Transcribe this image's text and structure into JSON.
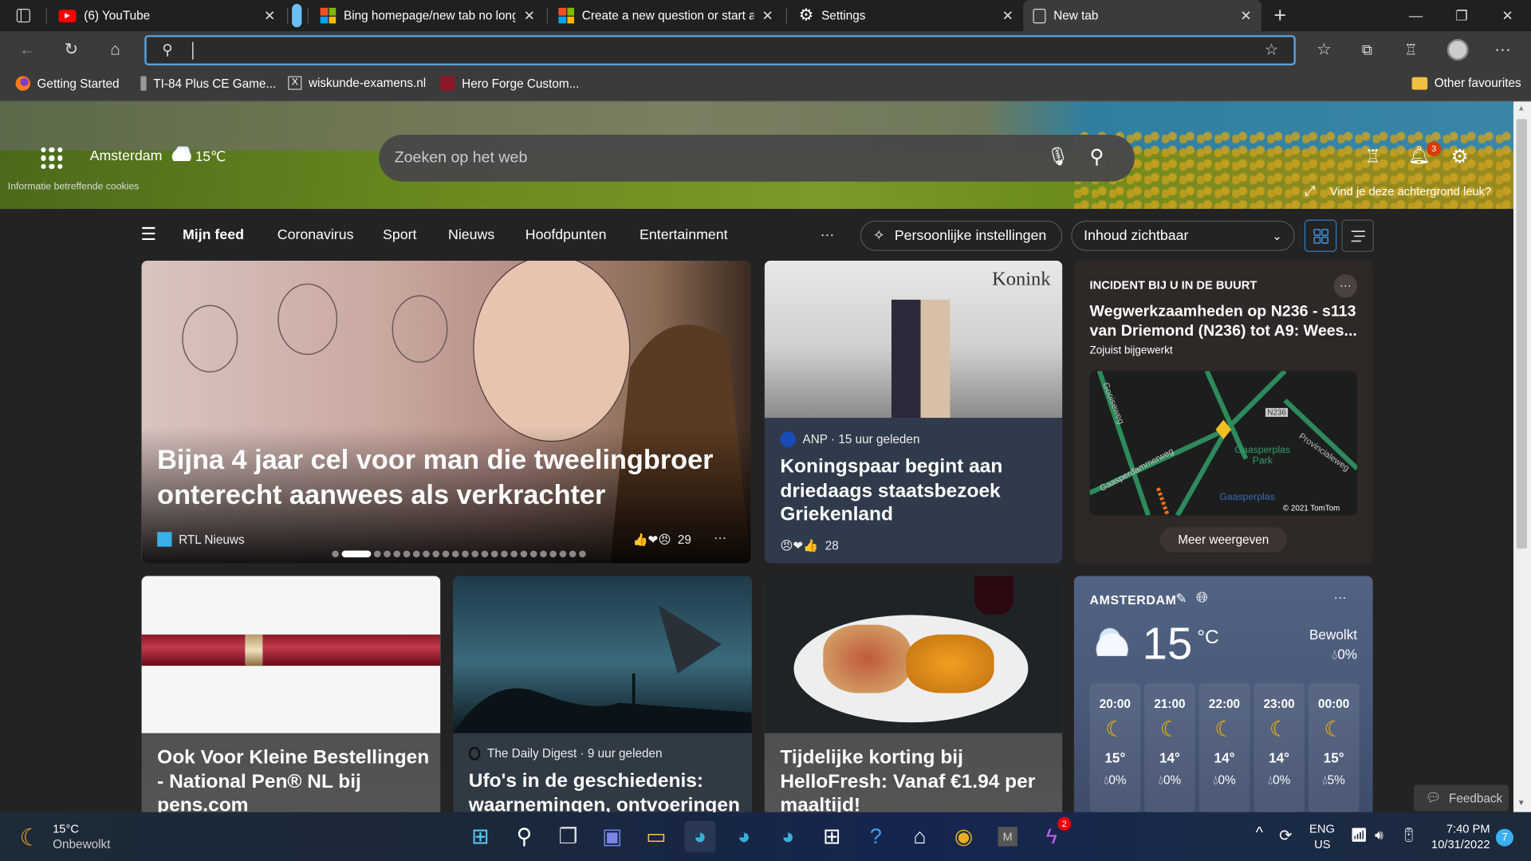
{
  "browser": {
    "tabs": [
      {
        "title": "(6) YouTube",
        "icon": "youtube-icon"
      },
      {
        "title": "Bing homepage/new tab no long",
        "icon": "microsoft-icon"
      },
      {
        "title": "Create a new question or start a",
        "icon": "microsoft-icon"
      },
      {
        "title": "Settings",
        "icon": "gear-icon"
      },
      {
        "title": "New tab",
        "icon": "new-tab-icon",
        "active": true
      }
    ],
    "close_glyph": "✕",
    "new_tab_glyph": "+",
    "address_value": "",
    "bookmarks": [
      {
        "label": "Getting Started",
        "icon": "firefox-icon"
      },
      {
        "label": "TI-84 Plus CE Game...",
        "icon": "calculator-icon"
      },
      {
        "label": "wiskunde-examens.nl",
        "icon": "wiskunde-icon"
      },
      {
        "label": "Hero Forge Custom...",
        "icon": "heroforge-icon"
      }
    ],
    "other_favourites": "Other favourites",
    "accent": "#5aa0d8"
  },
  "header": {
    "city": "Amsterdam",
    "temp": "15℃",
    "cookies": "Informatie betreffende cookies",
    "search_placeholder": "Zoeken op het web",
    "notification_count": "3",
    "background_prompt": "Vind je deze achtergrond leuk?"
  },
  "nav": {
    "items": [
      "Mijn feed",
      "Coronavirus",
      "Sport",
      "Nieuws",
      "Hoofdpunten",
      "Entertainment"
    ],
    "more": "···",
    "personal_settings": "Persoonlijke instellingen",
    "content_select": "Inhoud zichtbaar"
  },
  "cards": {
    "hero": {
      "title": "Bijna 4 jaar cel voor man die tweelingbroer onterecht aanwees als verkrachter",
      "source": "RTL Nieuws",
      "reactions": "29",
      "slide_count": 24,
      "active_slide": 2
    },
    "royal": {
      "source": "ANP · 15 uur geleden",
      "title": "Koningspaar begint aan driedaags staatsbezoek Griekenland",
      "reactions": "28",
      "plane_text": "Konink"
    },
    "traffic": {
      "label": "INCIDENT BIJ U IN DE BUURT",
      "title": "Wegwerkzaamheden op N236 - s113 van Driemond (N236) tot A9: Wees...",
      "updated": "Zojuist bijgewerkt",
      "map_labels": [
        "Gooiseweg",
        "Gaasperdammerweg",
        "Gaasperplas Park",
        "Provincialeweg",
        "Gaasperplas",
        "N236"
      ],
      "map_credit": "© 2021 TomTom",
      "more": "Meer weergeven"
    },
    "pen": {
      "title": "Ook Voor Kleine Bestellingen - National Pen® NL bij pens.com"
    },
    "ufo": {
      "source": "The Daily Digest · 9 uur geleden",
      "title": "Ufo's in de geschiedenis: waarnemingen, ontvoeringen"
    },
    "hellofresh": {
      "title": "Tijdelijke korting bij HelloFresh: Vanaf €1.94 per maaltijd!"
    },
    "weather": {
      "city": "AMSTERDAM",
      "temp": "15",
      "unit": "°C",
      "condition": "Bewolkt",
      "precip": "0%",
      "hourly": [
        {
          "time": "20:00",
          "temp": "15°",
          "precip": "0%",
          "icon": "moon-icon"
        },
        {
          "time": "21:00",
          "temp": "14°",
          "precip": "0%",
          "icon": "moon-icon"
        },
        {
          "time": "22:00",
          "temp": "14°",
          "precip": "0%",
          "icon": "moon-icon"
        },
        {
          "time": "23:00",
          "temp": "14°",
          "precip": "0%",
          "icon": "moon-icon"
        },
        {
          "time": "00:00",
          "temp": "15°",
          "precip": "5%",
          "icon": "moon-cloud-icon"
        }
      ]
    }
  },
  "feedback": "Feedback",
  "taskbar": {
    "weather_temp": "15°C",
    "weather_text": "Onbewolkt",
    "lang1": "ENG",
    "lang2": "US",
    "time": "7:40 PM",
    "date": "10/31/2022",
    "notif_count": "7",
    "messenger_badge": "2",
    "apps": [
      "start-icon",
      "search-icon",
      "task-view-icon",
      "teams-icon",
      "file-explorer-icon",
      "edge-profile-icon",
      "edge-profile-icon",
      "edge-profile-icon",
      "store-icon",
      "help-icon",
      "app-icon",
      "chrome-icon",
      "m-app-icon",
      "messenger-icon"
    ],
    "m_letter": "M"
  }
}
